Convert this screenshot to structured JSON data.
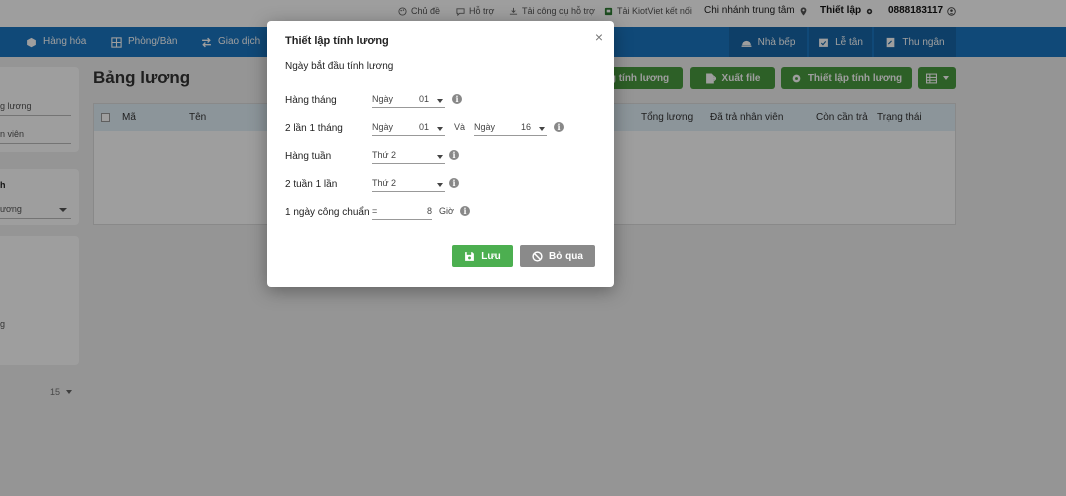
{
  "topbar": {
    "topic": "Chủ đề",
    "support": "Hỗ trợ",
    "download_tools": "Tải công cụ hỗ trợ",
    "download_app": "Tải KiotViet kết nối",
    "branch": "Chi nhánh trung tâm",
    "settings": "Thiết lập",
    "account": "0888183117"
  },
  "nav": {
    "items": [
      "Hàng hóa",
      "Phòng/Bàn",
      "Giao dịch"
    ],
    "kitchen": "Nhà bếp",
    "reception": "Lễ tân",
    "cashier": "Thu ngân"
  },
  "sidebar": {
    "box1": [
      "g lương",
      "n viên"
    ],
    "box2_title": "h",
    "box2_select": "ương",
    "box3": [
      "g"
    ],
    "page_size": "15"
  },
  "page": {
    "title": "Bảng lương",
    "btn_calc": "g tính lương",
    "btn_export": "Xuất file",
    "btn_setup": "Thiết lập tính lương",
    "columns": [
      "Mã",
      "Tên",
      "Tổng lương",
      "Đã trả nhân viên",
      "Còn cần trả",
      "Trạng thái"
    ]
  },
  "modal": {
    "title": "Thiết lập tính lương",
    "subtitle": "Ngày bắt đầu tính lương",
    "rows": {
      "monthly": {
        "label": "Hàng tháng",
        "prefix": "Ngày",
        "value": "01"
      },
      "twice_monthly": {
        "label": "2 lần 1 tháng",
        "prefix1": "Ngày",
        "value1": "01",
        "and": "Và",
        "prefix2": "Ngày",
        "value2": "16"
      },
      "weekly": {
        "label": "Hàng tuần",
        "value": "Thứ 2"
      },
      "biweekly": {
        "label": "2 tuần 1 lần",
        "value": "Thứ 2"
      },
      "standard_hours": {
        "label": "1 ngày công chuẩn",
        "eq": "=",
        "value": "8",
        "unit": "Giờ"
      }
    },
    "save": "Lưu",
    "cancel": "Bỏ qua",
    "close": "×"
  },
  "colors": {
    "nav": "#1a76c2",
    "nav_active": "#1767a9",
    "green": "#4a9b3f",
    "save": "#4caf50",
    "cancel": "#8a8a8a",
    "header_row": "#e3f0f9"
  }
}
